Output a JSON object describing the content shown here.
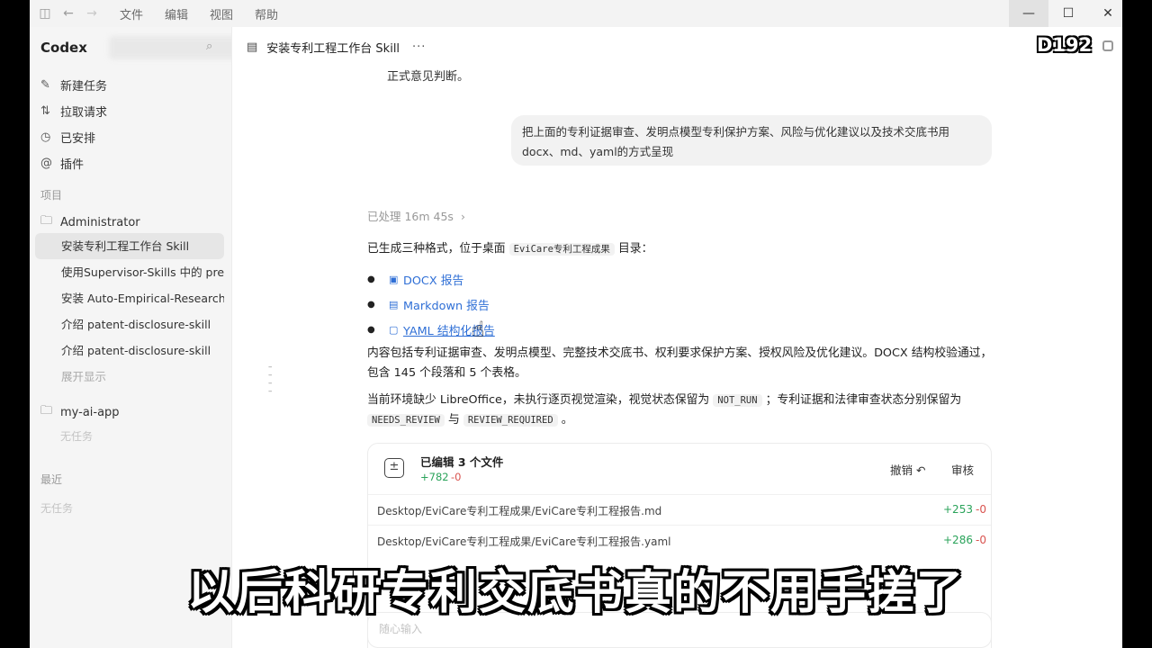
{
  "titlebar": {
    "menu": [
      "文件",
      "编辑",
      "视图",
      "帮助"
    ],
    "controls": {
      "minimize": "—",
      "maximize": "☐",
      "close": "✕"
    }
  },
  "sidebar": {
    "brand": "Codex",
    "nav": [
      {
        "label": "新建任务",
        "icon": "edit-icon"
      },
      {
        "label": "拉取请求",
        "icon": "pull-request-icon"
      },
      {
        "label": "已安排",
        "icon": "clock-icon"
      },
      {
        "label": "插件",
        "icon": "at-icon"
      }
    ],
    "projects_label": "项目",
    "project1": "Administrator",
    "project1_items": [
      "安装专利工程工作台 Skill",
      "使用Supervisor-Skills 中的 pre",
      "安装 Auto-Empirical-Research",
      "介绍 patent-disclosure-skill",
      "介绍 patent-disclosure-skill"
    ],
    "show_more": "展开显示",
    "project2": "my-ai-app",
    "project2_empty": "无任务",
    "recent_label": "最近",
    "recent_empty": "无任务"
  },
  "main": {
    "title": "安装专利工程工作台 Skill",
    "more": "···",
    "prev_text": "正式意见判断。",
    "user_message": "把上面的专利证据审查、发明点模型专利保护方案、风险与优化建议以及技术交底书用docx、md、yaml的方式呈现",
    "processed": "已处理 16m 45s",
    "generated_prefix": "已生成三种格式，位于桌面",
    "generated_dir": "EviCare专利工程成果",
    "generated_suffix": "目录：",
    "links": [
      {
        "label": "DOCX 报告",
        "icon": "docx-file-icon"
      },
      {
        "label": "Markdown 报告",
        "icon": "markdown-file-icon"
      },
      {
        "label": "YAML 结构化报告",
        "icon": "yaml-file-icon"
      }
    ],
    "content_para": "内容包括专利证据审查、发明点模型、完整技术交底书、权利要求保护方案、授权风险及优化建议。DOCX 结构校验通过，包含 145 个段落和 5 个表格。",
    "env_prefix": "当前环境缺少 LibreOffice，未执行逐页视觉渲染，视觉状态保留为",
    "env_code1": "NOT_RUN",
    "env_mid": "；专利证据和法律审查状态分别保留为",
    "env_code2": "NEEDS_REVIEW",
    "env_and": "与",
    "env_code3": "REVIEW_REQUIRED",
    "env_end": "。",
    "card": {
      "title": "已编辑 3 个文件",
      "added": "+782",
      "deleted": "-0",
      "undo": "撤销 ↶",
      "review": "审核",
      "files": [
        {
          "path": "Desktop/EviCare专利工程成果/EviCare专利工程报告.md",
          "added": "+253",
          "deleted": "-0"
        },
        {
          "path": "Desktop/EviCare专利工程成果/EviCare专利工程报告.yaml",
          "added": "+286",
          "deleted": "-0"
        }
      ]
    },
    "composer_placeholder": "随心输入"
  },
  "overlay": {
    "tag": "D192",
    "subtitle": "以后科研专利交底书真的不用手搓了"
  }
}
